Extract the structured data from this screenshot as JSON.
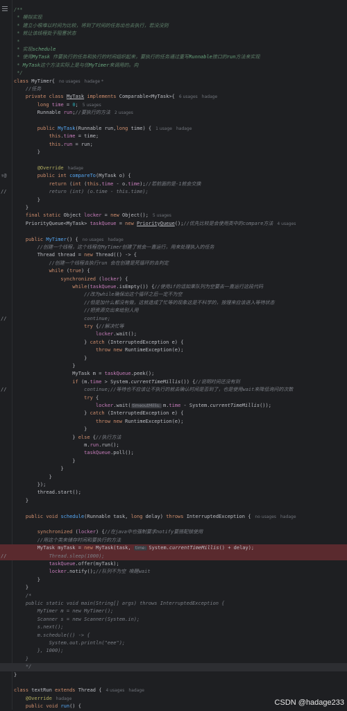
{
  "editor": {
    "watermark": "CSDN @hadage233",
    "gutter_marks": {
      "override": "↑@",
      "comment": "//"
    }
  },
  "lines": [
    {
      "parts": [
        [
          "doc",
          "/**"
        ]
      ]
    },
    {
      "parts": [
        [
          "doc",
          " * 模拟实现"
        ]
      ]
    },
    {
      "parts": [
        [
          "doc",
          " * 建立小根堆以时间为比较，将到了时间的任务出也去执行，若没没则"
        ]
      ]
    },
    {
      "parts": [
        [
          "doc",
          " * 就让该线程处于阻塞状态"
        ]
      ]
    },
    {
      "parts": [
        [
          "doc",
          " *"
        ]
      ]
    },
    {
      "parts": [
        [
          "doc",
          " * 实现"
        ],
        [
          "doctag",
          "schedule"
        ]
      ]
    },
    {
      "parts": [
        [
          "doc",
          " * 使用"
        ],
        [
          "doctag",
          "MyTask"
        ],
        [
          "doc",
          " 作要执行的任务和执行的时间组织起来，要执行的任务通过重写"
        ],
        [
          "doctag",
          "Runnable"
        ],
        [
          "doc",
          "接口的"
        ],
        [
          "doctag",
          "run"
        ],
        [
          "doc",
          "方法来实现"
        ]
      ]
    },
    {
      "parts": [
        [
          "doc",
          " * "
        ],
        [
          "doctag",
          "MyTask"
        ],
        [
          "doc",
          "这个方法实际上是与优"
        ],
        [
          "doctag",
          "MyTimer"
        ],
        [
          "doc",
          "来调用的。向"
        ]
      ]
    },
    {
      "parts": [
        [
          "doc",
          " */"
        ]
      ]
    },
    {
      "parts": [
        [
          "kw",
          "class "
        ],
        [
          "",
          "MyTimer{"
        ],
        [
          "hint",
          "no usages"
        ],
        [
          "hinta",
          "hadage *"
        ]
      ]
    },
    {
      "parts": [
        [
          "cm",
          "    //任务"
        ]
      ]
    },
    {
      "parts": [
        [
          "kw",
          "    private class "
        ],
        [
          "ul",
          "MyTask"
        ],
        [
          "kw",
          " implements "
        ],
        [
          "",
          "Comparable<MyTask>{"
        ],
        [
          "hint",
          "6 usages"
        ],
        [
          "hinta",
          "hadage"
        ]
      ]
    },
    {
      "parts": [
        [
          "kw",
          "        long "
        ],
        [
          "fld",
          "time"
        ],
        [
          "",
          " = "
        ],
        [
          "num",
          "0"
        ],
        [
          ";"
        ],
        [
          "hint",
          "5 usages"
        ]
      ]
    },
    {
      "parts": [
        [
          "",
          "        Runnable "
        ],
        [
          "fld",
          "run"
        ],
        [
          ";"
        ],
        [
          "cm",
          "//要执行的方法"
        ],
        [
          "hint",
          "2 usages"
        ]
      ]
    },
    {
      "parts": [
        [
          "",
          ""
        ]
      ]
    },
    {
      "parts": [
        [
          "kw",
          "        public "
        ],
        [
          "fn",
          "MyTask"
        ],
        [
          "",
          "(Runnable run,"
        ],
        [
          "kw",
          "long "
        ],
        [
          "",
          "time) {"
        ],
        [
          "hint",
          "1 usage"
        ],
        [
          "hinta",
          "hadage"
        ]
      ]
    },
    {
      "parts": [
        [
          "kw",
          "            this"
        ],
        [
          "",
          "."
        ],
        [
          "fld",
          "time"
        ],
        [
          "",
          " = time;"
        ]
      ]
    },
    {
      "parts": [
        [
          "kw",
          "            this"
        ],
        [
          "",
          "."
        ],
        [
          "fld",
          "run"
        ],
        [
          "",
          " = run;"
        ]
      ]
    },
    {
      "parts": [
        [
          "",
          "        }"
        ]
      ]
    },
    {
      "parts": [
        [
          "",
          ""
        ]
      ]
    },
    {
      "parts": [
        [
          "ann",
          "        @Override"
        ],
        [
          "hinta",
          "hadage"
        ]
      ]
    },
    {
      "gm": "override",
      "parts": [
        [
          "kw",
          "        public int "
        ],
        [
          "fn",
          "compareTo"
        ],
        [
          "",
          "(MyTask o) {"
        ]
      ]
    },
    {
      "parts": [
        [
          "kw",
          "            return "
        ],
        [
          "",
          "("
        ],
        [
          "kw",
          "int"
        ],
        [
          "",
          " ("
        ],
        [
          "kw",
          "this"
        ],
        [
          "",
          "."
        ],
        [
          "fld",
          "time"
        ],
        [
          "",
          " - o."
        ],
        [
          "fld",
          "time"
        ],
        [
          ");"
        ],
        [
          "cm",
          "//若前面的是-1就会交换"
        ]
      ]
    },
    {
      "gm": "comment",
      "parts": [
        [
          "cm",
          "            return (int) (o.time - this.time);"
        ]
      ]
    },
    {
      "parts": [
        [
          "",
          "        }"
        ]
      ]
    },
    {
      "parts": [
        [
          "",
          "    }"
        ]
      ]
    },
    {
      "parts": [
        [
          "kw",
          "    final static "
        ],
        [
          "",
          "Object "
        ],
        [
          "fld",
          "locker"
        ],
        [
          "",
          " = "
        ],
        [
          "kw",
          "new "
        ],
        [
          "",
          "Object();"
        ],
        [
          "hint",
          "5 usages"
        ]
      ]
    },
    {
      "parts": [
        [
          "",
          "    PriorityQueue<MyTask> "
        ],
        [
          "fld",
          "taskQueue"
        ],
        [
          "",
          " = "
        ],
        [
          "kw",
          "new "
        ],
        [
          "ul",
          "PriorityQueue"
        ],
        [
          "",
          "();"
        ],
        [
          "cm",
          "//优先比较是会使用类中的compare方法"
        ],
        [
          "hint",
          "4 usages"
        ]
      ]
    },
    {
      "parts": [
        [
          "",
          ""
        ]
      ]
    },
    {
      "parts": [
        [
          "kw",
          "    public "
        ],
        [
          "fn",
          "MyTimer"
        ],
        [
          "",
          "() {"
        ],
        [
          "hint",
          "no usages"
        ],
        [
          "hinta",
          "hadage"
        ]
      ]
    },
    {
      "parts": [
        [
          "cm",
          "        //创建一个线程，这个线程在MyTimer创建了就会一直运行，用来处理执入的任务"
        ]
      ]
    },
    {
      "parts": [
        [
          "",
          "        Thread thread = "
        ],
        [
          "kw",
          "new "
        ],
        [
          "",
          "Thread(() -> {"
        ]
      ]
    },
    {
      "parts": [
        [
          "cm",
          "            //创建一个线程去执行run 会在创建是死循环的去判定"
        ]
      ]
    },
    {
      "parts": [
        [
          "kw",
          "            while "
        ],
        [
          "",
          "("
        ],
        [
          "kw",
          "true"
        ],
        [
          ") {"
        ]
      ]
    },
    {
      "parts": [
        [
          "kw",
          "                synchronized "
        ],
        [
          "",
          "("
        ],
        [
          "fld",
          "locker"
        ],
        [
          ") {"
        ]
      ]
    },
    {
      "parts": [
        [
          "kw",
          "                    while"
        ],
        [
          "",
          "("
        ],
        [
          "fld",
          "taskQueue"
        ],
        [
          ".isEmpty()) {"
        ],
        [
          "cm",
          "//使用if的话如果队列为空要去一直运行这段代码"
        ]
      ]
    },
    {
      "parts": [
        [
          "cm",
          "                        //改为while确保出这个循环之后一定不为空"
        ]
      ]
    },
    {
      "parts": [
        [
          "cm",
          "                        //但是加什么都没有做，这就造成了忙等的现象这是不科学的，按理来应该进入等待状态"
        ]
      ]
    },
    {
      "parts": [
        [
          "cm",
          "                        //把资源交出来给别人用"
        ]
      ]
    },
    {
      "gm": "comment",
      "parts": [
        [
          "cm",
          "                        continue;"
        ]
      ]
    },
    {
      "parts": [
        [
          "kw",
          "                        try "
        ],
        [
          "",
          "{"
        ],
        [
          "cm",
          "//解决忙等"
        ]
      ]
    },
    {
      "parts": [
        [
          "",
          "                            "
        ],
        [
          "fld",
          "locker"
        ],
        [
          ".wait();"
        ]
      ]
    },
    {
      "parts": [
        [
          "",
          "                        } "
        ],
        [
          "kw",
          "catch "
        ],
        [
          "",
          "(InterruptedException e) {"
        ]
      ]
    },
    {
      "parts": [
        [
          "kw",
          "                            throw new "
        ],
        [
          "",
          "RuntimeException(e);"
        ]
      ]
    },
    {
      "parts": [
        [
          "",
          "                        }"
        ]
      ]
    },
    {
      "parts": [
        [
          "",
          "                    }"
        ]
      ]
    },
    {
      "parts": [
        [
          "",
          "                    MyTask m = "
        ],
        [
          "fld",
          "taskQueue"
        ],
        [
          ".peek();"
        ]
      ]
    },
    {
      "parts": [
        [
          "kw",
          "                    if "
        ],
        [
          "",
          "(m."
        ],
        [
          "fld",
          "time"
        ],
        [
          "",
          " > System."
        ],
        [
          "st",
          "currentTimeMillis"
        ],
        [
          "",
          "()) {"
        ],
        [
          "cm",
          "//说明时间还没有到"
        ]
      ]
    },
    {
      "gm": "comment",
      "parts": [
        [
          "cm",
          "                        continue;//等待也不应该让不执行的就去确认时间是否到了，也是使用wait来降低询问的次数"
        ]
      ]
    },
    {
      "parts": [
        [
          "kw",
          "                        try"
        ],
        [
          "",
          " {"
        ]
      ]
    },
    {
      "parts": [
        [
          "",
          "                            "
        ],
        [
          "fld",
          "locker"
        ],
        [
          ".wait("
        ],
        [
          "param",
          "timeoutMillis:"
        ],
        [
          "",
          "m."
        ],
        [
          "fld",
          "time"
        ],
        [
          "",
          " - System."
        ],
        [
          "st",
          "currentTimeMillis"
        ],
        [
          "",
          "());"
        ]
      ]
    },
    {
      "parts": [
        [
          "",
          "                        } "
        ],
        [
          "kw",
          "catch "
        ],
        [
          "",
          "(InterruptedException e) {"
        ]
      ]
    },
    {
      "parts": [
        [
          "kw",
          "                            throw new "
        ],
        [
          "",
          "RuntimeException(e);"
        ]
      ]
    },
    {
      "parts": [
        [
          "",
          "                        }"
        ]
      ]
    },
    {
      "parts": [
        [
          "",
          "                    } "
        ],
        [
          "kw",
          "else "
        ],
        [
          "",
          "{"
        ],
        [
          "cm",
          "//执行方法"
        ]
      ]
    },
    {
      "parts": [
        [
          "",
          "                        m."
        ],
        [
          "fld",
          "run"
        ],
        [
          ".run();"
        ]
      ]
    },
    {
      "parts": [
        [
          "",
          "                        "
        ],
        [
          "fld",
          "taskQueue"
        ],
        [
          ".poll();"
        ]
      ]
    },
    {
      "parts": [
        [
          "",
          "                    }"
        ]
      ]
    },
    {
      "parts": [
        [
          "",
          "                }"
        ]
      ]
    },
    {
      "parts": [
        [
          "",
          "            }"
        ]
      ]
    },
    {
      "parts": [
        [
          "",
          "        });"
        ]
      ]
    },
    {
      "parts": [
        [
          "",
          "        thread.start();"
        ]
      ]
    },
    {
      "parts": [
        [
          "",
          "    }"
        ]
      ]
    },
    {
      "parts": [
        [
          "",
          ""
        ]
      ]
    },
    {
      "parts": [
        [
          "kw",
          "    public void "
        ],
        [
          "fn",
          "schedule"
        ],
        [
          "",
          "(Runnable task, "
        ],
        [
          "kw",
          "long "
        ],
        [
          "",
          "delay) "
        ],
        [
          "kw",
          "throws "
        ],
        [
          "",
          "InterruptedException {"
        ],
        [
          "hint",
          "no usages"
        ],
        [
          "hinta",
          "hadage"
        ]
      ]
    },
    {
      "parts": [
        [
          "",
          ""
        ]
      ]
    },
    {
      "parts": [
        [
          "kw",
          "        synchronized "
        ],
        [
          "",
          "("
        ],
        [
          "fld",
          "locker"
        ],
        [
          ") {"
        ],
        [
          "cm",
          "//在java中也强制要求notify要搭配锁使用"
        ]
      ]
    },
    {
      "parts": [
        [
          "cm",
          "        //用这个类来储存时间和要执行的方法"
        ]
      ]
    },
    {
      "hl": "hl",
      "parts": [
        [
          "",
          "        MyTask myTask = "
        ],
        [
          "kw",
          "new "
        ],
        [
          "",
          "MyTask(task, "
        ],
        [
          "param",
          "time:"
        ],
        [
          "",
          "System."
        ],
        [
          "st",
          "currentTimeMillis"
        ],
        [
          "",
          "() + delay);"
        ]
      ]
    },
    {
      "hl": "hl",
      "gm": "comment",
      "parts": [
        [
          "cm",
          "            Thread.sleep(1000);"
        ]
      ]
    },
    {
      "parts": [
        [
          "",
          "            "
        ],
        [
          "fld",
          "taskQueue"
        ],
        [
          ".offer(myTask);"
        ]
      ]
    },
    {
      "parts": [
        [
          "",
          "            "
        ],
        [
          "fld",
          "locker"
        ],
        [
          ".notify();"
        ],
        [
          "cm",
          "//队列不为空 唤醒wait"
        ]
      ]
    },
    {
      "parts": [
        [
          "",
          "        }"
        ]
      ]
    },
    {
      "parts": [
        [
          "",
          "    }"
        ]
      ]
    },
    {
      "parts": [
        [
          "cm",
          "    /*"
        ]
      ]
    },
    {
      "parts": [
        [
          "cm",
          "    public static void main(String[] args) throws InterruptedException {"
        ]
      ]
    },
    {
      "parts": [
        [
          "cm",
          "        MyTimer m = new MyTimer();"
        ]
      ]
    },
    {
      "parts": [
        [
          "cm",
          "        Scanner s = new Scanner(System.in);"
        ]
      ]
    },
    {
      "parts": [
        [
          "cm",
          "        s.next();"
        ]
      ]
    },
    {
      "parts": [
        [
          "cm",
          "        m.schedule(() -> {"
        ]
      ]
    },
    {
      "parts": [
        [
          "cm",
          "            System.out.println(\"eee\");"
        ]
      ]
    },
    {
      "parts": [
        [
          "cm",
          "        }, 1000);"
        ]
      ]
    },
    {
      "parts": [
        [
          "cm",
          "    }"
        ]
      ]
    },
    {
      "hl": "hl2",
      "parts": [
        [
          "cm",
          "    */"
        ]
      ]
    },
    {
      "parts": [
        [
          "",
          "}"
        ]
      ]
    },
    {
      "parts": [
        [
          "",
          ""
        ]
      ]
    },
    {
      "parts": [
        [
          "kw",
          "class "
        ],
        [
          "",
          "textRun "
        ],
        [
          "kw",
          "extends "
        ],
        [
          "",
          "Thread {"
        ],
        [
          "hint",
          "4 usages"
        ],
        [
          "hinta",
          "hadage"
        ]
      ]
    },
    {
      "parts": [
        [
          "ann",
          "    @Override"
        ],
        [
          "hinta",
          "hadage"
        ]
      ]
    },
    {
      "parts": [
        [
          "kw",
          "    public void "
        ],
        [
          "fn",
          "run"
        ],
        [
          "",
          "() {"
        ]
      ]
    }
  ]
}
